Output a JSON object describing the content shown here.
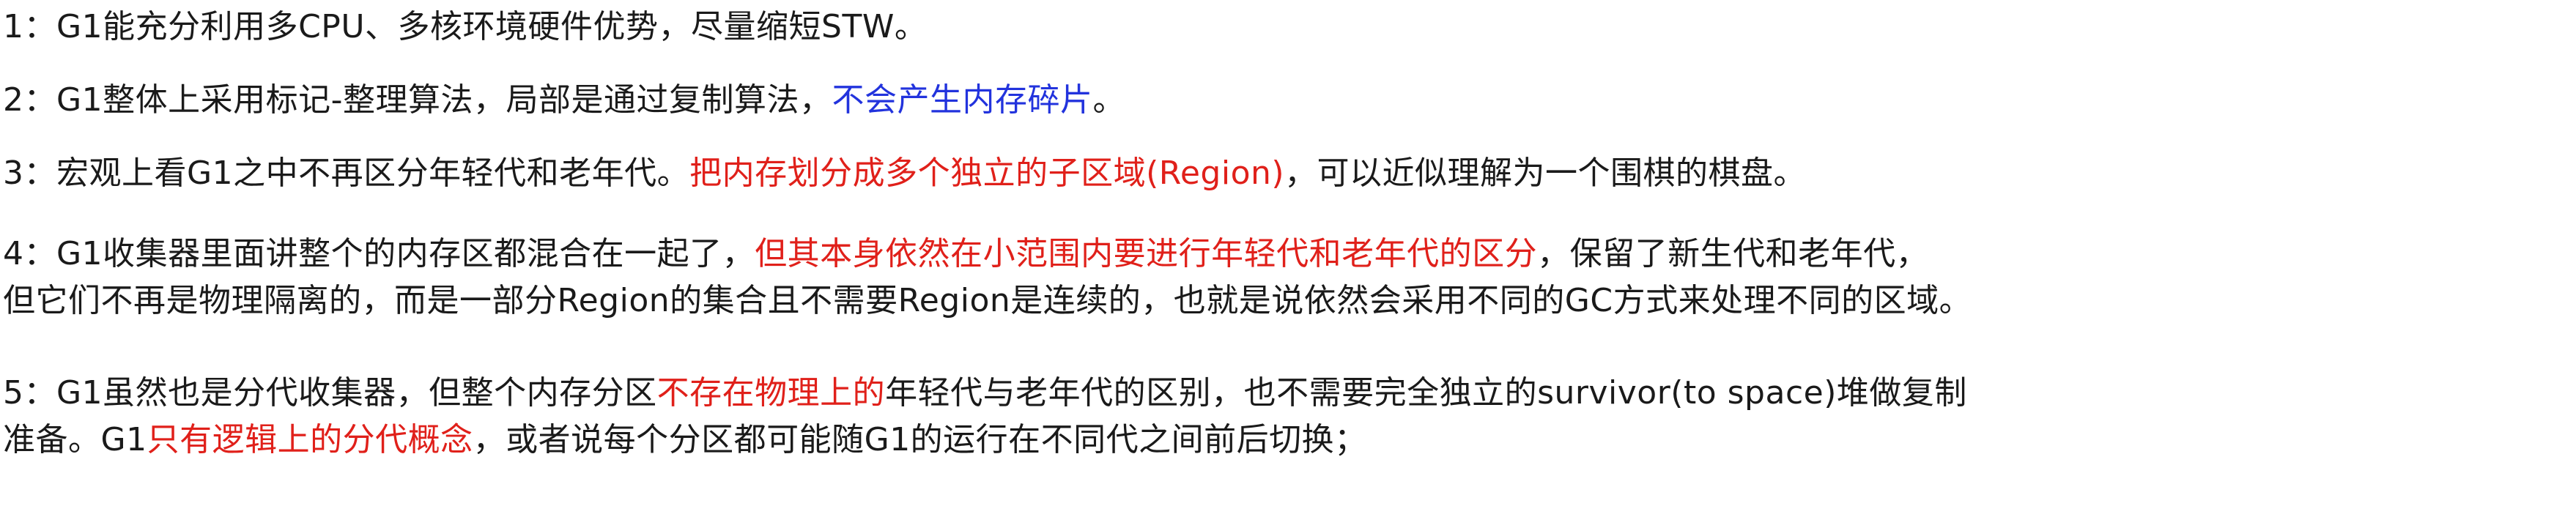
{
  "colors": {
    "text": "#1a1a1a",
    "highlight_red": "#e0201a",
    "highlight_blue": "#2233dd",
    "background": "#ffffff"
  },
  "points": [
    {
      "lines": [
        [
          {
            "text": "1：G1能充分利用多CPU、多核环境硬件优势，尽量缩短STW。",
            "color": "default"
          }
        ]
      ]
    },
    {
      "lines": [
        [
          {
            "text": "2：G1整体上采用标记-整理算法，局部是通过复制算法，",
            "color": "default"
          },
          {
            "text": "不会产生内存碎片",
            "color": "blue"
          },
          {
            "text": "。",
            "color": "default"
          }
        ]
      ]
    },
    {
      "lines": [
        [
          {
            "text": "3：宏观上看G1之中不再区分年轻代和老年代。",
            "color": "default"
          },
          {
            "text": "把内存划分成多个独立的子区域(Region)",
            "color": "red"
          },
          {
            "text": "，可以近似理解为一个围棋的棋盘。",
            "color": "default"
          }
        ]
      ]
    },
    {
      "lines": [
        [
          {
            "text": "4：G1收集器里面讲整个的内存区都混合在一起了，",
            "color": "default"
          },
          {
            "text": "但其本身依然在小范围内要进行年轻代和老年代的区分",
            "color": "red"
          },
          {
            "text": "，保留了新生代和老年代，",
            "color": "default"
          }
        ],
        [
          {
            "text": "但它们不再是物理隔离的，而是一部分Region的集合且不需要Region是连续的，也就是说依然会采用不同的GC方式来处理不同的区域。",
            "color": "default"
          }
        ]
      ]
    },
    {
      "lines": [
        [
          {
            "text": "5：G1虽然也是分代收集器，但整个内存分区",
            "color": "default"
          },
          {
            "text": "不存在物理上的",
            "color": "red"
          },
          {
            "text": "年轻代与老年代的区别，也不需要完全独立的survivor(to space)堆做复制",
            "color": "default"
          }
        ],
        [
          {
            "text": "准备。G1",
            "color": "default"
          },
          {
            "text": "只有逻辑上的分代概念",
            "color": "red"
          },
          {
            "text": "，或者说每个分区都可能随G1的运行在不同代之间前后切换；",
            "color": "default"
          }
        ]
      ]
    }
  ]
}
